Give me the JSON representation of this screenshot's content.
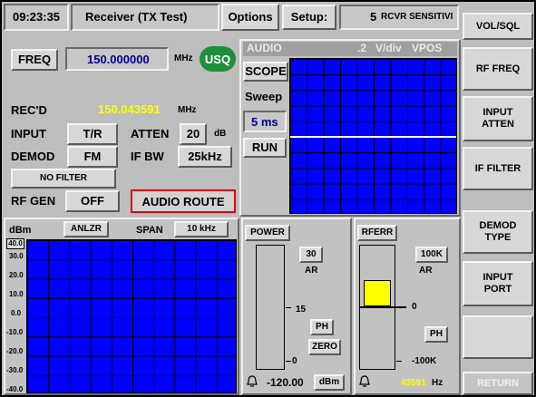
{
  "top_bar": {
    "time": "09:23:35",
    "mode_title": "Receiver (TX Test)",
    "options_label": "Options",
    "setup_label": "Setup:",
    "setup_number": "5",
    "setup_value": "RCVR SENSITIVI"
  },
  "receiver": {
    "freq_label": "FREQ",
    "freq_value": "150.000000",
    "freq_unit": "MHz",
    "usq_badge": "USQ",
    "recd_label": "REC'D",
    "recd_value": "150.043591",
    "recd_unit": "MHz",
    "input_label": "INPUT",
    "input_value": "T/R",
    "atten_label": "ATTEN",
    "atten_value": "20",
    "atten_unit": "dB",
    "demod_label": "DEMOD",
    "demod_value": "FM",
    "ifbw_label": "IF BW",
    "ifbw_value": "25kHz",
    "filter_label": "NO FILTER",
    "rfgen_label": "RF GEN",
    "rfgen_value": "OFF",
    "audio_route_label": "AUDIO ROUTE"
  },
  "scope": {
    "audio_label": "AUDIO",
    "vdiv_value": ".2",
    "vdiv_unit": "V/div",
    "vpos_label": "VPOS",
    "scope_label": "SCOPE",
    "sweep_label": "Sweep",
    "sweep_value": "5 ms",
    "run_label": "RUN"
  },
  "analyzer": {
    "unit_label": "dBm",
    "mode_label": "ANLZR",
    "span_label": "SPAN",
    "span_value": "10 kHz",
    "ref_level": "40.0",
    "y_ticks": [
      "30.0",
      "20.0",
      "10.0",
      "0.0",
      "-10.0",
      "-20.0",
      "-30.0",
      "-40.0"
    ]
  },
  "power_meter": {
    "title": "POWER",
    "range_value": "30",
    "range_mode": "AR",
    "scale_mid": "15",
    "scale_low": "0",
    "ph_label": "PH",
    "zero_label": "ZERO",
    "reading_value": "-120.00",
    "reading_unit": "dBm"
  },
  "rferr_meter": {
    "title": "RFERR",
    "range_value": "100K",
    "range_mode": "AR",
    "scale_zero": "0",
    "scale_low": "-100K",
    "ph_label": "PH",
    "reading_value": "43591",
    "reading_unit": "Hz",
    "bar_fraction": 0.2,
    "bar_color": "#ffff00"
  },
  "softkeys": {
    "key1": "VOL/SQL",
    "key2": "RF FREQ",
    "key3": "INPUT ATTEN",
    "key4": "IF FILTER",
    "key5": "DEMOD TYPE",
    "key6": "INPUT PORT",
    "key7": "",
    "key8": "RETURN"
  },
  "icons": {
    "power_bell": "bell-icon",
    "rferr_bell": "bell-icon"
  },
  "colors": {
    "grid_blue": "#0000ff",
    "recd_yellow": "#ffff00",
    "usq_green": "#1f8f3a",
    "audio_route_border": "#e00000",
    "value_blue": "#00008b"
  }
}
